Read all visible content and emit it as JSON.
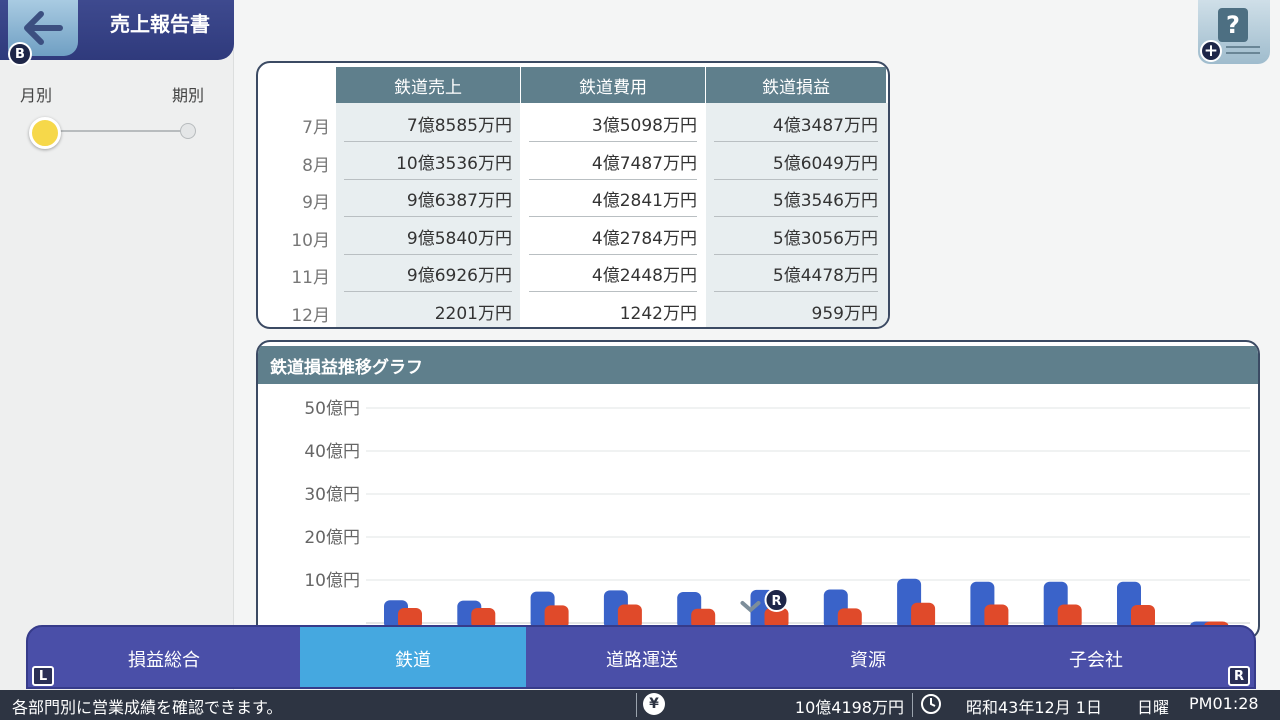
{
  "header": {
    "title": "売上報告書",
    "back_button_badge": "B",
    "back_icon": "left-arrow-icon"
  },
  "help": {
    "icon": "question-icon",
    "plus": "+"
  },
  "period": {
    "left_label": "月別",
    "right_label": "期別",
    "selected": "月別"
  },
  "table": {
    "columns": [
      "鉄道売上",
      "鉄道費用",
      "鉄道損益"
    ],
    "rows": [
      {
        "month": "7月",
        "values": [
          "7億8585万円",
          "3億5098万円",
          "4億3487万円"
        ]
      },
      {
        "month": "8月",
        "values": [
          "10億3536万円",
          "4億7487万円",
          "5億6049万円"
        ]
      },
      {
        "month": "9月",
        "values": [
          "9億6387万円",
          "4億2841万円",
          "5億3546万円"
        ]
      },
      {
        "month": "10月",
        "values": [
          "9億5840万円",
          "4億2784万円",
          "5億3056万円"
        ]
      },
      {
        "month": "11月",
        "values": [
          "9億6926万円",
          "4億2448万円",
          "5億4478万円"
        ]
      },
      {
        "month": "12月",
        "values": [
          "2201万円",
          "1242万円",
          "959万円"
        ]
      }
    ]
  },
  "chart_title": "鉄道損益推移グラフ",
  "chart_data": {
    "type": "bar",
    "title": "鉄道損益推移グラフ",
    "ylim": [
      0,
      50
    ],
    "y_ticks": [
      "10億円",
      "20億円",
      "30億円",
      "40億円",
      "50億円"
    ],
    "y_tick_values": [
      10,
      20,
      30,
      40,
      50
    ],
    "grid": true,
    "series": [
      {
        "values": [
          5.3,
          5.2,
          7.3,
          7.6,
          7.2,
          7.7,
          7.8,
          10.3,
          9.6,
          9.6,
          9.6,
          0.2
        ],
        "color": "#3a63c9"
      },
      {
        "values": [
          3.5,
          3.5,
          4.1,
          4.3,
          3.3,
          3.5,
          3.4,
          4.7,
          4.3,
          4.3,
          4.2,
          0.1
        ],
        "color": "#e04a2a"
      }
    ],
    "current_marker_index": 5,
    "current_marker_badge": "R"
  },
  "tabs": [
    {
      "label": "損益総合",
      "active": false
    },
    {
      "label": "鉄道",
      "active": true
    },
    {
      "label": "道路運送",
      "active": false
    },
    {
      "label": "資源",
      "active": false
    },
    {
      "label": "子会社",
      "active": false
    }
  ],
  "shoulder_buttons": {
    "left": "L",
    "right": "R"
  },
  "status": {
    "message": "各部門別に営業成績を確認できます。",
    "money_icon": "yen-icon",
    "money": "10億4198万円",
    "clock_icon": "clock-icon",
    "date": "昭和43年12月 1日",
    "weekday": "日曜",
    "time": "PM01:28"
  }
}
